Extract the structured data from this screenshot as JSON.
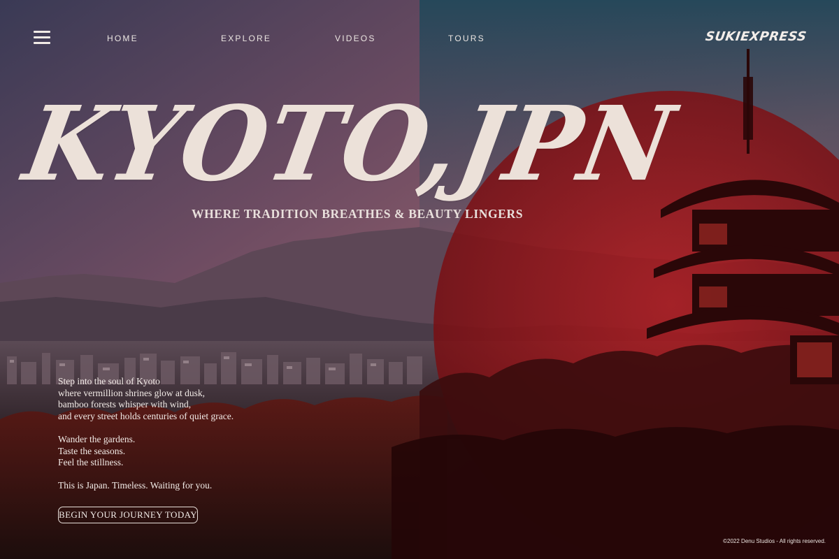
{
  "nav": {
    "menu_icon": "hamburger-menu-icon",
    "items": [
      {
        "label": "HOME"
      },
      {
        "label": "EXPLORE"
      },
      {
        "label": "VIDEOS"
      },
      {
        "label": "TOURS"
      }
    ],
    "brand": "SUKIEXPRESS"
  },
  "hero": {
    "title": "KYOTO,JPN",
    "subtitle": "WHERE TRADITION BREATHES & BEAUTY LINGERS"
  },
  "intro": {
    "lines_1": [
      "Step into the soul of Kyoto",
      "where vermillion shrines glow at dusk,",
      "bamboo forests whisper with wind,",
      "and every street holds centuries of quiet grace."
    ],
    "lines_2": [
      "Wander the gardens.",
      "Taste the seasons.",
      "Feel the stillness."
    ],
    "closing": "This is Japan. Timeless. Waiting for you."
  },
  "cta": {
    "label": "BEGIN YOUR JOURNEY TODAY"
  },
  "footer": {
    "copyright": "©2022 Denu Studios - All rights reserved."
  },
  "colors": {
    "title_cream": "#ece1d9",
    "sun_red": "#a0161a",
    "sky_top": "#2b4655",
    "sky_dusk": "#8a5a66"
  }
}
